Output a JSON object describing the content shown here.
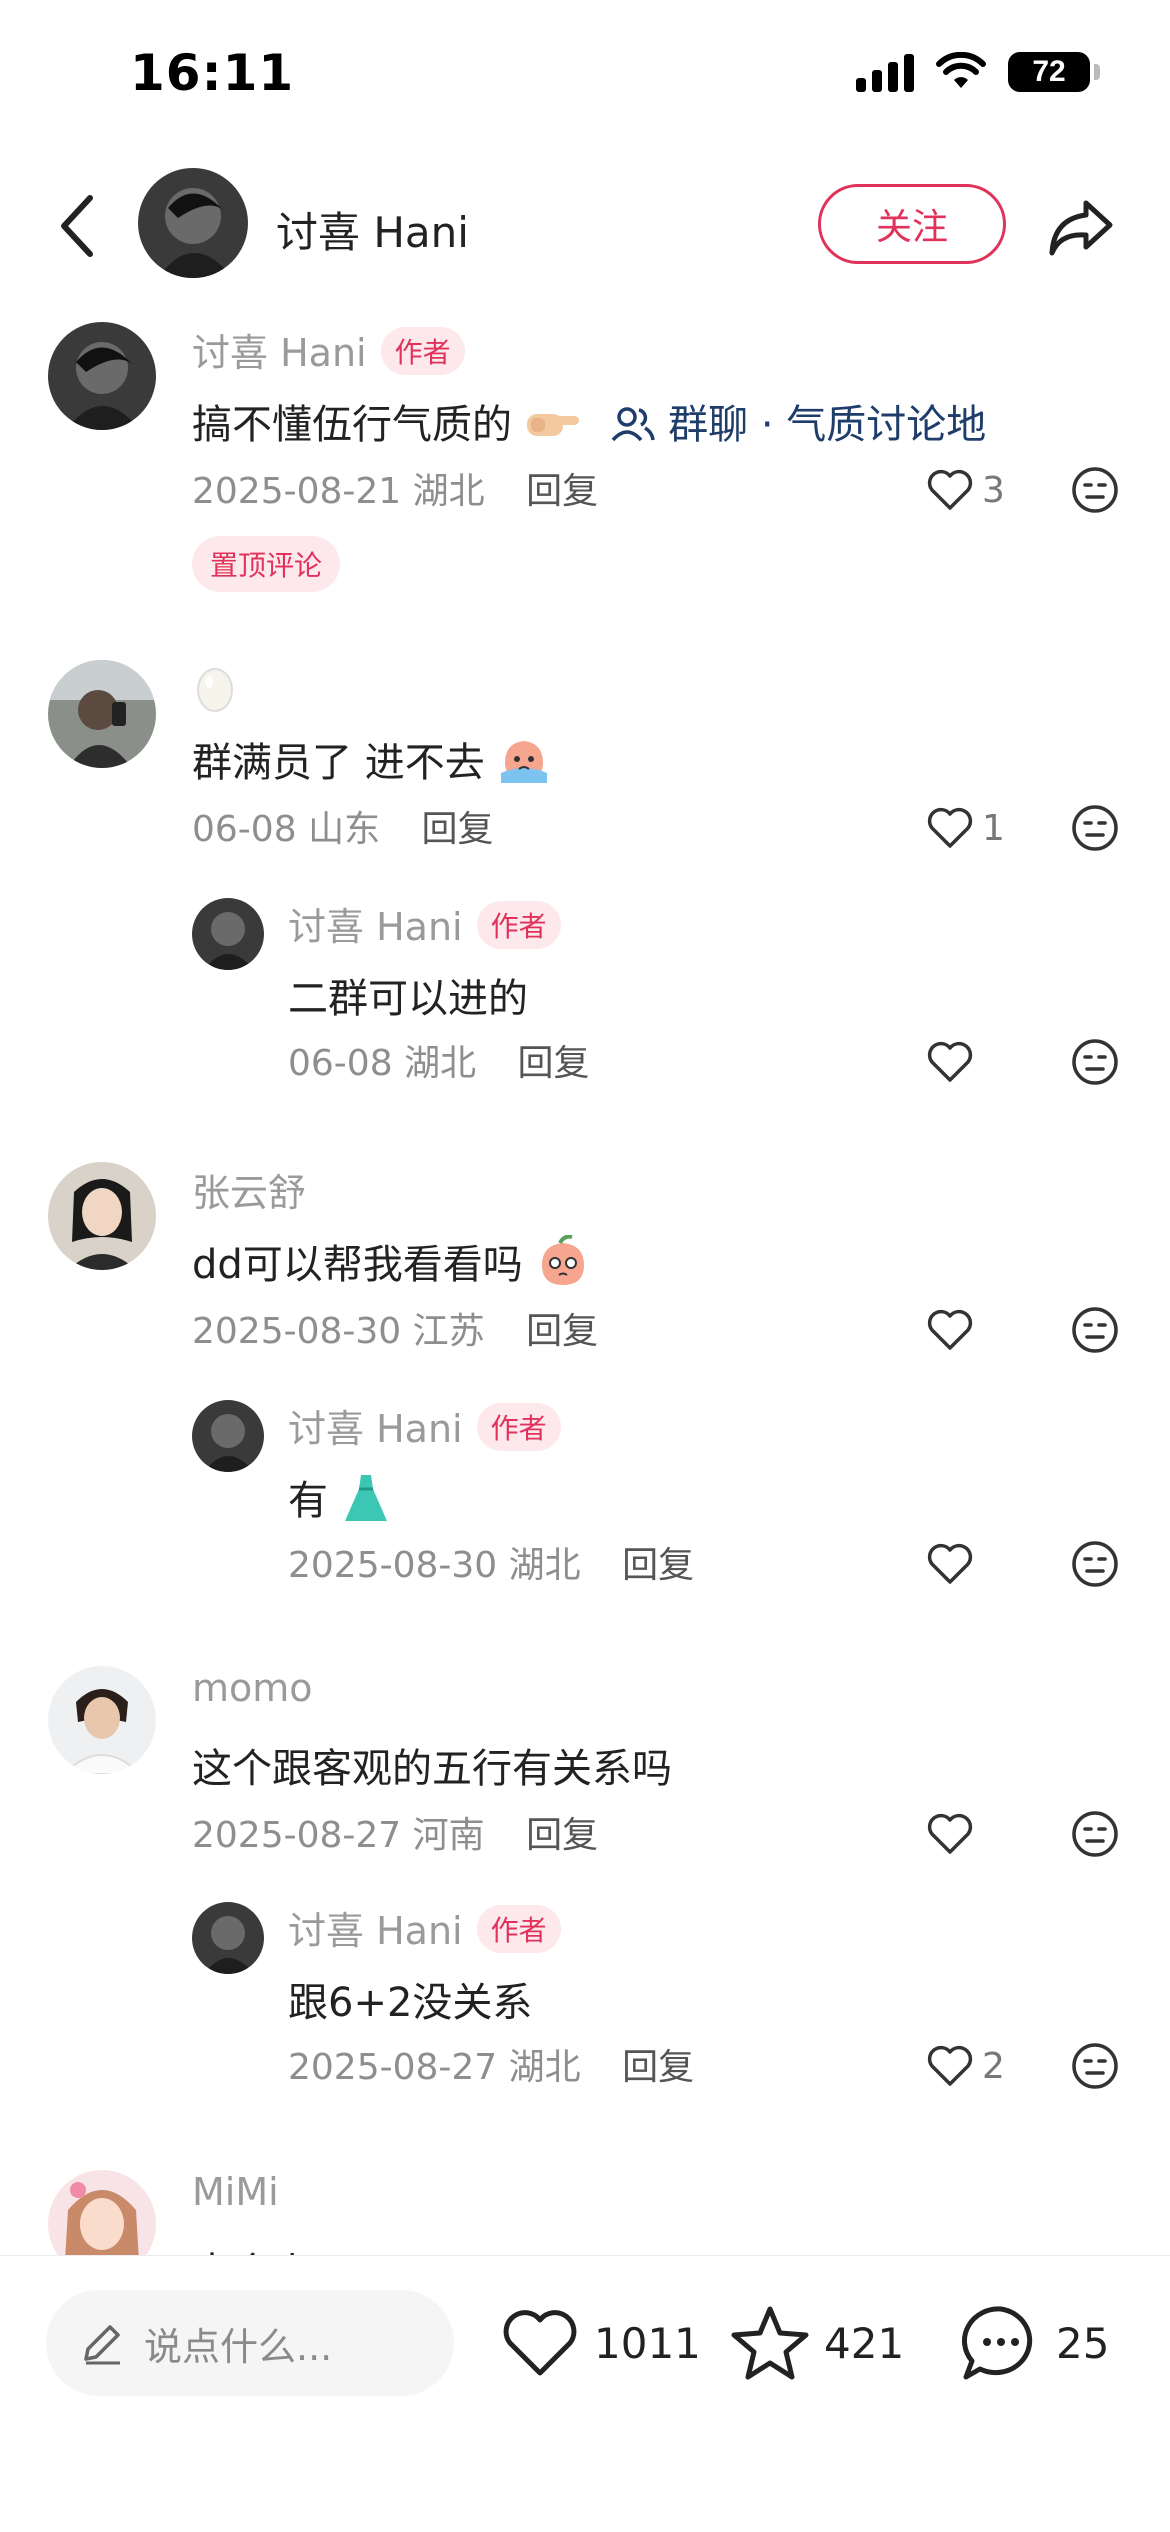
{
  "status_bar": {
    "time": "16:11",
    "battery": "72"
  },
  "header": {
    "name": "讨喜 Hani",
    "follow_label": "关注"
  },
  "comments": [
    {
      "name": "讨喜 Hani",
      "tag": "作者",
      "text": "搞不懂伍行气质的",
      "group_link": "群聊 · 气质讨论地",
      "date": "2025-08-21",
      "location": "湖北",
      "reply_label": "回复",
      "likes": "3",
      "pin": "置顶评论"
    },
    {
      "name": "",
      "text": "群满员了 进不去",
      "date": "06-08",
      "location": "山东",
      "reply_label": "回复",
      "likes": "1",
      "reply": {
        "name": "讨喜 Hani",
        "tag": "作者",
        "text": "二群可以进的",
        "date": "06-08",
        "location": "湖北",
        "reply_label": "回复",
        "likes": ""
      }
    },
    {
      "name": "张云舒",
      "text": "dd可以帮我看看吗",
      "date": "2025-08-30",
      "location": "江苏",
      "reply_label": "回复",
      "likes": "",
      "reply": {
        "name": "讨喜 Hani",
        "tag": "作者",
        "text": "有",
        "date": "2025-08-30",
        "location": "湖北",
        "reply_label": "回复",
        "likes": ""
      }
    },
    {
      "name": "momo",
      "text": "这个跟客观的五行有关系吗",
      "date": "2025-08-27",
      "location": "河南",
      "reply_label": "回复",
      "likes": "",
      "reply": {
        "name": "讨喜 Hani",
        "tag": "作者",
        "text": "跟6+2没关系",
        "date": "2025-08-27",
        "location": "湖北",
        "reply_label": "回复",
        "likes": "2"
      }
    },
    {
      "name": "MiMi",
      "text": "大会小吧"
    }
  ],
  "bottom_bar": {
    "placeholder": "说点什么...",
    "likes": "1011",
    "favorites": "421",
    "comments": "25"
  },
  "colors": {
    "accent": "#e0325a",
    "link": "#1f3d6b",
    "muted": "#9a9a9a"
  }
}
